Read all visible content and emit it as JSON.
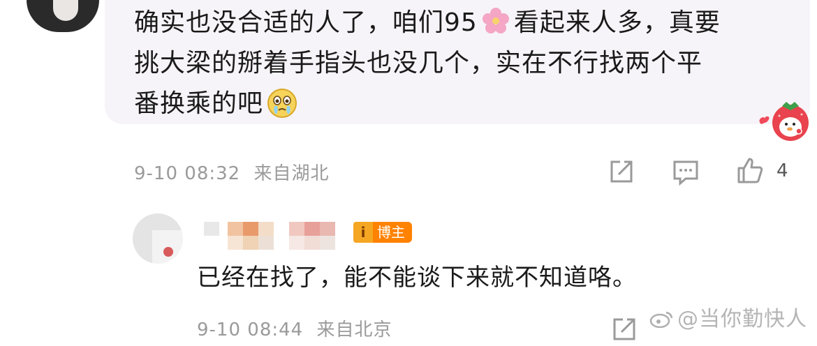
{
  "comment": {
    "line1_before": "确实也没合适的人了，咱们95",
    "line1_after": "看起来人多，真要",
    "line2": "挑大梁的掰着手指头也没几个，实在不行找两个平",
    "line3": "番换乘的吧",
    "flower_icon": "cherry-blossom-emoji",
    "cry_icon": "crying-face-emoji",
    "timestamp": "9-10 08:32",
    "location": "来自湖北",
    "like_count": "4"
  },
  "reply": {
    "badge_mark": "i",
    "badge_label": "博主",
    "text": "已经在找了，能不能谈下来就不知道咯。",
    "timestamp": "9-10 08:44",
    "location": "来自北京"
  },
  "watermark": {
    "text": "@当你勤快人"
  },
  "colors": {
    "bubble_bg": "#f6f4f8",
    "meta_text": "#9a9a9a",
    "badge_orange": "#ff8200"
  }
}
